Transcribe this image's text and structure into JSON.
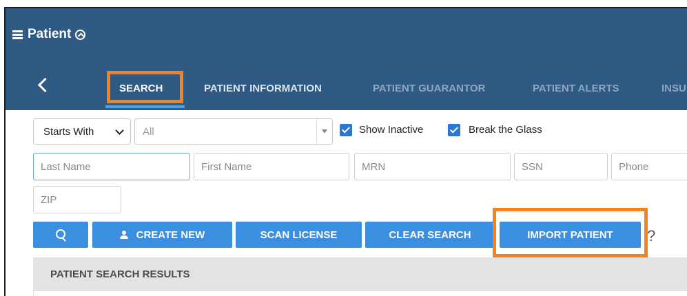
{
  "header": {
    "title": "Patient",
    "menu_icon": "hamburger-icon",
    "collapse_icon": "chevron-up-circle-icon",
    "back_icon": "chevron-left-icon",
    "background_color": "#2e5a84"
  },
  "tabs": [
    {
      "label": "SEARCH",
      "active": true
    },
    {
      "label": "PATIENT INFORMATION"
    },
    {
      "label": "PATIENT GUARANTOR"
    },
    {
      "label": "PATIENT ALERTS"
    },
    {
      "label": "INSU"
    }
  ],
  "filters": {
    "match_mode": "Starts With",
    "scope": "All",
    "show_inactive": {
      "label": "Show Inactive",
      "checked": true
    },
    "break_glass": {
      "label": "Break the Glass",
      "checked": true
    }
  },
  "fields": {
    "last_name": "Last Name",
    "first_name": "First Name",
    "mrn": "MRN",
    "ssn": "SSN",
    "phone": "Phone",
    "zip": "ZIP"
  },
  "buttons": {
    "search_icon": "search-icon",
    "create_new": "CREATE NEW",
    "scan_license": "SCAN LICENSE",
    "clear_search": "CLEAR SEARCH",
    "import_patient": "IMPORT PATIENT",
    "help": "?",
    "color": "#3b8fe0"
  },
  "results": {
    "title": "PATIENT SEARCH RESULTS"
  },
  "highlight_color": "#f58220"
}
